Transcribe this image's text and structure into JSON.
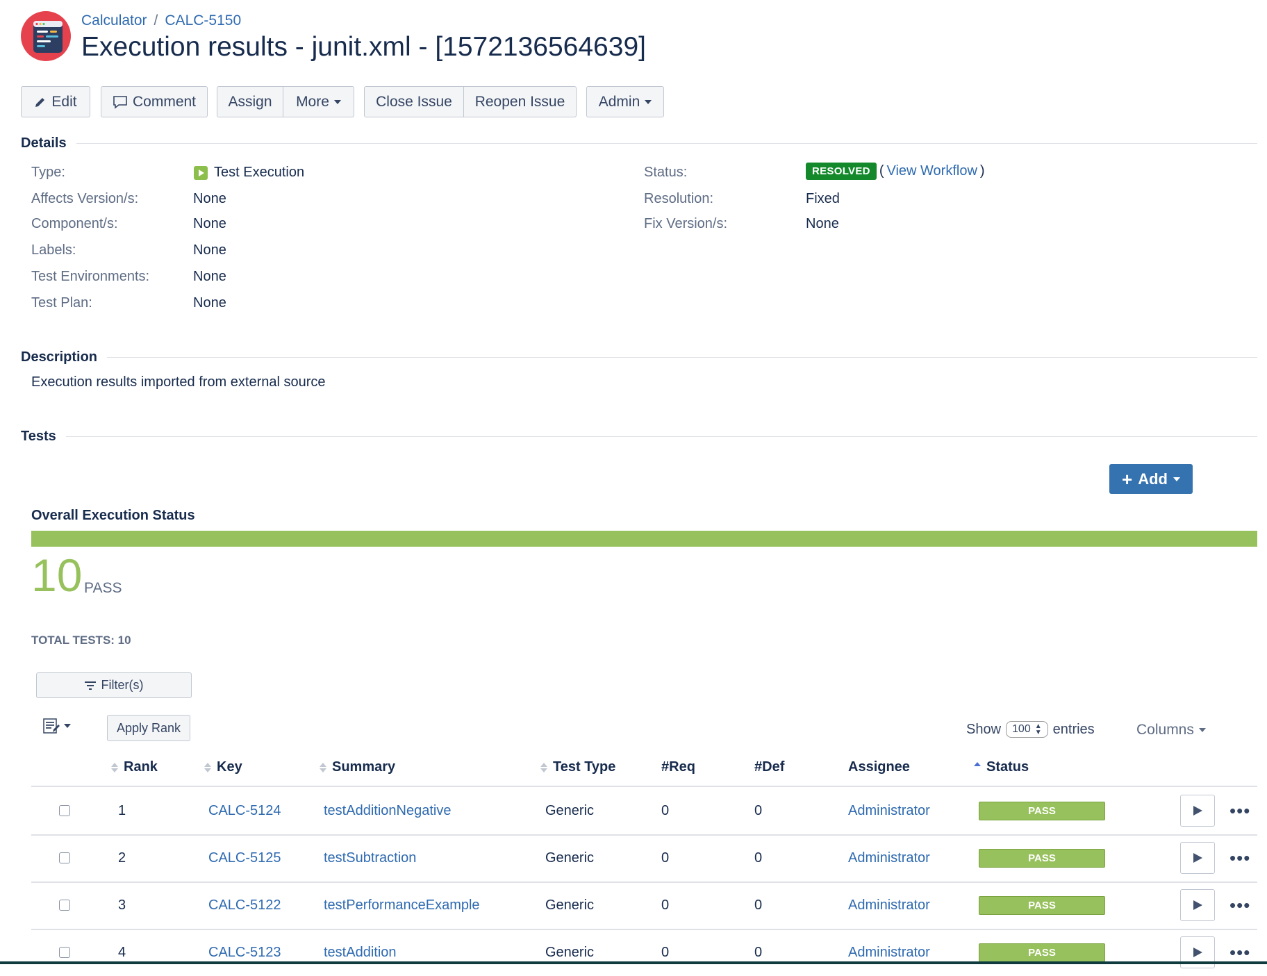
{
  "header": {
    "breadcrumb": {
      "project": "Calculator",
      "separator": "/",
      "issue_key": "CALC-5150"
    },
    "title": "Execution results - junit.xml - [1572136564639]"
  },
  "toolbar": {
    "edit": "Edit",
    "comment": "Comment",
    "assign": "Assign",
    "more": "More",
    "close_issue": "Close Issue",
    "reopen_issue": "Reopen Issue",
    "admin": "Admin"
  },
  "details": {
    "heading": "Details",
    "left": [
      {
        "label": "Type:",
        "value": "Test Execution"
      },
      {
        "label": "Affects Version/s:",
        "value": "None"
      },
      {
        "label": "Component/s:",
        "value": "None"
      },
      {
        "label": "Labels:",
        "value": "None"
      },
      {
        "label": "Test Environments:",
        "value": "None"
      },
      {
        "label": "Test Plan:",
        "value": "None"
      }
    ],
    "right": [
      {
        "label": "Status:",
        "value": "RESOLVED",
        "link_open": "(",
        "link": "View Workflow",
        "link_close": ")"
      },
      {
        "label": "Resolution:",
        "value": "Fixed"
      },
      {
        "label": "Fix Version/s:",
        "value": "None"
      }
    ]
  },
  "description": {
    "heading": "Description",
    "text": "Execution results imported from external source"
  },
  "tests": {
    "heading": "Tests",
    "add_button": "Add",
    "overall_heading": "Overall Execution Status",
    "pass_count": "10",
    "pass_label": "PASS",
    "pass_fraction": 1.0,
    "total_tests": "TOTAL TESTS: 10",
    "filter_button": "Filter(s)",
    "apply_rank_button": "Apply Rank",
    "show_label": "Show",
    "page_size": "100",
    "entries_label": "entries",
    "columns_button": "Columns",
    "columns": {
      "rank": "Rank",
      "key": "Key",
      "summary": "Summary",
      "test_type": "Test Type",
      "req": "#Req",
      "def": "#Def",
      "assignee": "Assignee",
      "status": "Status"
    },
    "rows": [
      {
        "rank": "1",
        "key": "CALC-5124",
        "summary": "testAdditionNegative",
        "test_type": "Generic",
        "req": "0",
        "def": "0",
        "assignee": "Administrator",
        "status": "PASS"
      },
      {
        "rank": "2",
        "key": "CALC-5125",
        "summary": "testSubtraction",
        "test_type": "Generic",
        "req": "0",
        "def": "0",
        "assignee": "Administrator",
        "status": "PASS"
      },
      {
        "rank": "3",
        "key": "CALC-5122",
        "summary": "testPerformanceExample",
        "test_type": "Generic",
        "req": "0",
        "def": "0",
        "assignee": "Administrator",
        "status": "PASS"
      },
      {
        "rank": "4",
        "key": "CALC-5123",
        "summary": "testAddition",
        "test_type": "Generic",
        "req": "0",
        "def": "0",
        "assignee": "Administrator",
        "status": "PASS"
      }
    ]
  },
  "colors": {
    "pass": "#97c15c",
    "resolved": "#14892c",
    "link": "#2e6ab0",
    "primary_button": "#3572b0"
  }
}
